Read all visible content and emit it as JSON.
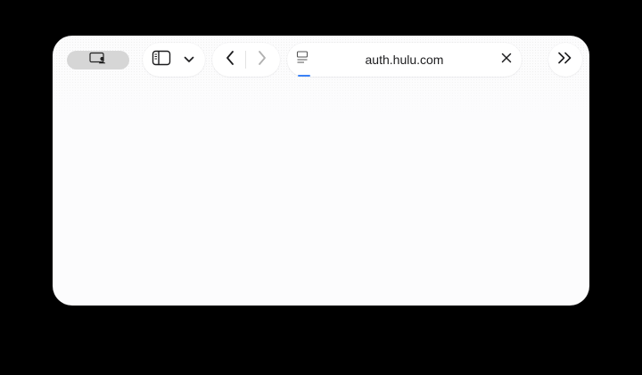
{
  "toolbar": {
    "profile_icon": "window-person-icon",
    "sidebar_icon": "sidebar-icon",
    "sidebar_menu_icon": "chevron-down-icon",
    "back_icon": "chevron-left-icon",
    "forward_icon": "chevron-right-icon",
    "reader_icon": "page-lines-icon",
    "url": "auth.hulu.com",
    "stop_icon": "close-icon",
    "overflow_icon": "double-chevron-right-icon",
    "page_load_progress": 0.05
  },
  "colors": {
    "background": "#000000",
    "window": "#fcfcfd",
    "profile_pill": "#d6d6d6",
    "progress_accent": "#3b82f6"
  }
}
